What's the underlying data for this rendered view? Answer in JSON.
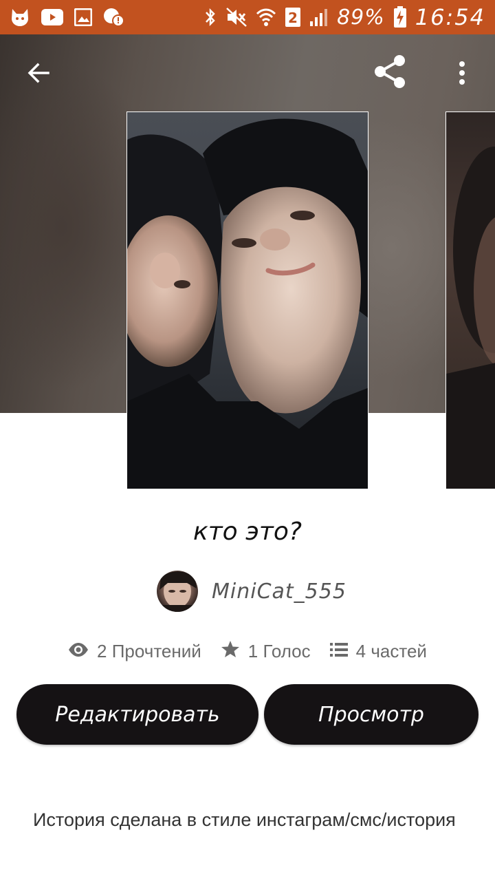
{
  "status_bar": {
    "battery": "89%",
    "sim_slot": "2",
    "time": "16:54",
    "icons": [
      "cat-notification-icon",
      "youtube-icon",
      "gallery-icon",
      "alert-chat-icon",
      "bluetooth-icon",
      "mute-icon",
      "wifi-icon",
      "sim-icon",
      "signal-icon",
      "battery-charging-icon"
    ],
    "bg_color": "#c2521f"
  },
  "app_bar": {
    "back_icon": "arrow-left-icon",
    "share_icon": "share-icon",
    "more_icon": "more-vert-icon"
  },
  "story": {
    "title": "кто это?",
    "author": "MiniCat_555",
    "stats": {
      "reads": "2 Прочтений",
      "votes": "1 Голос",
      "parts": "4 частей"
    },
    "description": "История сделана в стиле инстаграм/смс/история"
  },
  "actions": {
    "edit_label": "Редактировать",
    "preview_label": "Просмотр"
  },
  "colors": {
    "button_bg": "#151214",
    "accent": "#c2521f"
  }
}
